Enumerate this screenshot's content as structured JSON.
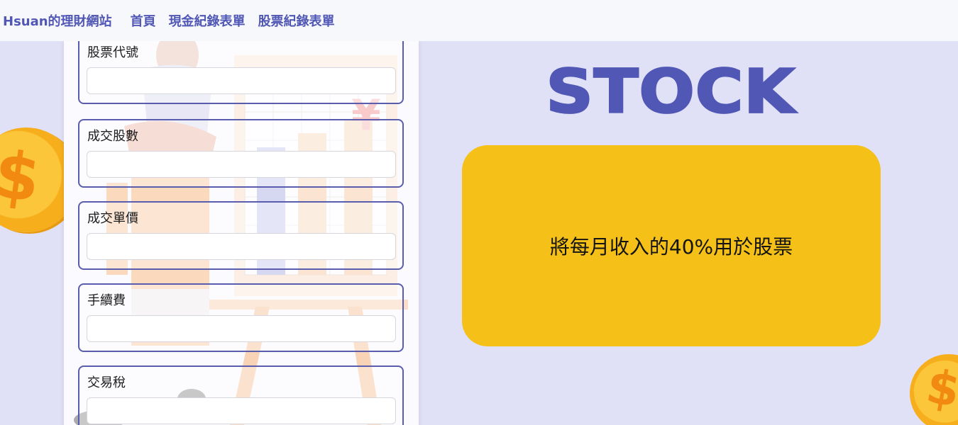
{
  "navbar": {
    "brand": "Hsuan的理財網站",
    "links": [
      {
        "label": "首頁"
      },
      {
        "label": "現金紀錄表單"
      },
      {
        "label": "股票紀錄表單"
      }
    ]
  },
  "form": {
    "fields": [
      {
        "label": "股票代號",
        "value": "",
        "placeholder": ""
      },
      {
        "label": "成交股數",
        "value": "",
        "placeholder": ""
      },
      {
        "label": "成交單價",
        "value": "",
        "placeholder": ""
      },
      {
        "label": "手續費",
        "value": "",
        "placeholder": ""
      },
      {
        "label": "交易稅",
        "value": "",
        "placeholder": ""
      }
    ]
  },
  "hero": {
    "heading": "STOCK",
    "card_text": "將每月收入的40%用於股票"
  },
  "decorations": {
    "coin_symbol": "$",
    "coin_color": "#f7ae1c",
    "accent_color": "#5057b5",
    "card_color": "#f5c017"
  }
}
